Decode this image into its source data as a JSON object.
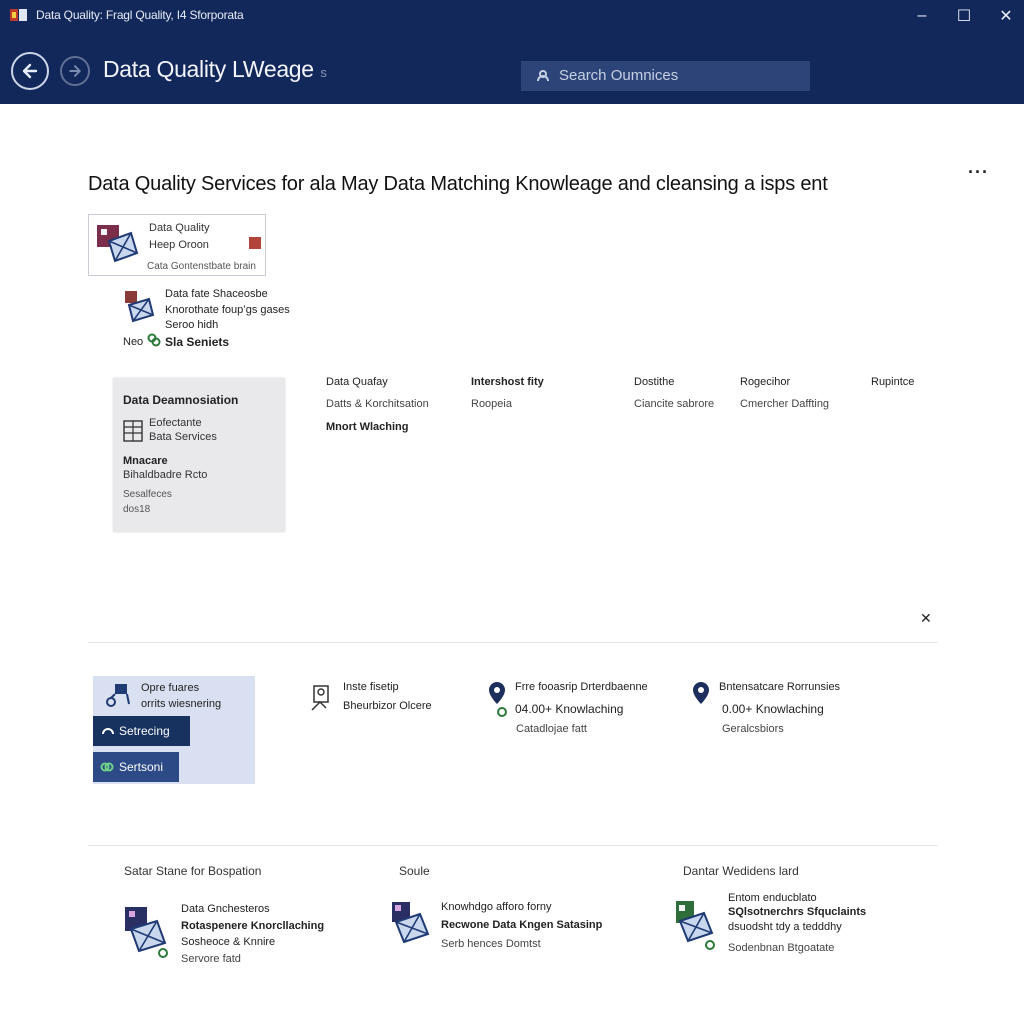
{
  "window": {
    "title": "Data Quality: Fragl Quality, I4 Sforporata",
    "minimize": "–",
    "maximize": "☐",
    "close": "✕"
  },
  "nav": {
    "app_name": "Data Quality LWeage",
    "app_name_suffix": "  s",
    "search_placeholder": "Search Oumnices"
  },
  "page": {
    "title": "Data Quality Services for ala  May  Data Matching Knowleage and cleansing a isps ent",
    "more_label": "···"
  },
  "card": {
    "line1": "Data Quality",
    "line2": "Heep Oroon",
    "line3": "Cata Gontenstbate brain"
  },
  "info": {
    "name": "Data fate Shaceosbe",
    "sub": "Knorothate foup’gs gases",
    "sub2": "Seroo hidh",
    "foot_prefix": "Neo",
    "foot_label": "Sla Seniets"
  },
  "panel": {
    "heading": "Data Deamnosiation",
    "item1": "Eofectante",
    "item2": "Bata Services",
    "item3": "Mnacare",
    "item4": "Bihaldbadre Rcto",
    "item5": "Sesalfeces",
    "item6": "dos18"
  },
  "grid": {
    "headers": [
      "Data Quafay",
      "Intershost fity",
      "Dostithe",
      "Rogecihor",
      "Rupintce"
    ],
    "row2": [
      "Datts & Korchitsation",
      "Roopeia",
      "Ciancite sabrore",
      "Cmercher Daffting"
    ],
    "row3": [
      "Mnort Wlaching"
    ]
  },
  "section2": {
    "close_label": "✕",
    "panel_line1": "Opre fuares",
    "panel_line2": "orrits wiesnering",
    "setting_btn": "Setrecing",
    "service_btn": "Sertsoni"
  },
  "features": [
    {
      "l1": "Inste fisetip",
      "l2": "Bheurbizor Olcere",
      "l3": ""
    },
    {
      "l1": "Frre fooasrip Drterdbaenne",
      "l2": "04.00+ Knowlaching",
      "l3": "Catadlojae fatt"
    },
    {
      "l1": "Bntensatcare Rorrunsies",
      "l2": "0.00+ Knowlaching",
      "l3": "Geralcsbiors"
    }
  ],
  "footer": {
    "col1": {
      "heading": "Satar Stane for Bospation",
      "l1": "Data Gnchesteros",
      "l2": "Rotaspenere Knorcllaching",
      "l3": "Sosheoce & Knnire",
      "l4": "Servore fatd"
    },
    "col2": {
      "heading": "Soule",
      "l1": "Knowhdgo afforo forny",
      "l2": "Recwone Data Kngen Satasinp",
      "l3": "Serb hences Domtst"
    },
    "col3": {
      "heading": "Dantar Wedidens lard",
      "l1": "Entom enducblato",
      "l2": "SQlsotnerchrs Sfquclaints",
      "l3": "dsuodsht tdy a tedddhy",
      "l4": "Sodenbnan Btgoatate"
    }
  },
  "colors": {
    "titlebar": "#13285a",
    "search_bg": "#2c4478",
    "accent_dark": "#17325f",
    "accent": "#2b4a86",
    "panel_blue": "#d8e0f1"
  }
}
